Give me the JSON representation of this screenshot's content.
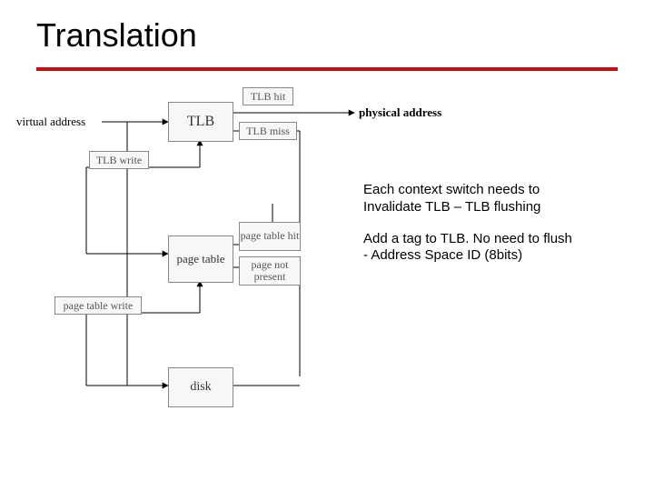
{
  "title": "Translation",
  "labels": {
    "virtual_address": "virtual address",
    "physical_address": "physical address",
    "tlb_hit": "TLB hit",
    "tlb_miss": "TLB miss",
    "tlb_write": "TLB write",
    "page_table_hit": "page table hit",
    "page_not_present": "page not present",
    "page_table_write": "page table write"
  },
  "boxes": {
    "tlb": "TLB",
    "page_table": "page table",
    "disk": "disk"
  },
  "notes": {
    "p1_l1": "Each context switch needs to",
    "p1_l2": "Invalidate TLB – TLB flushing",
    "p2_l1": "Add a tag to TLB. No need to flush",
    "p2_l2": "- Address Space ID (8bits)"
  }
}
